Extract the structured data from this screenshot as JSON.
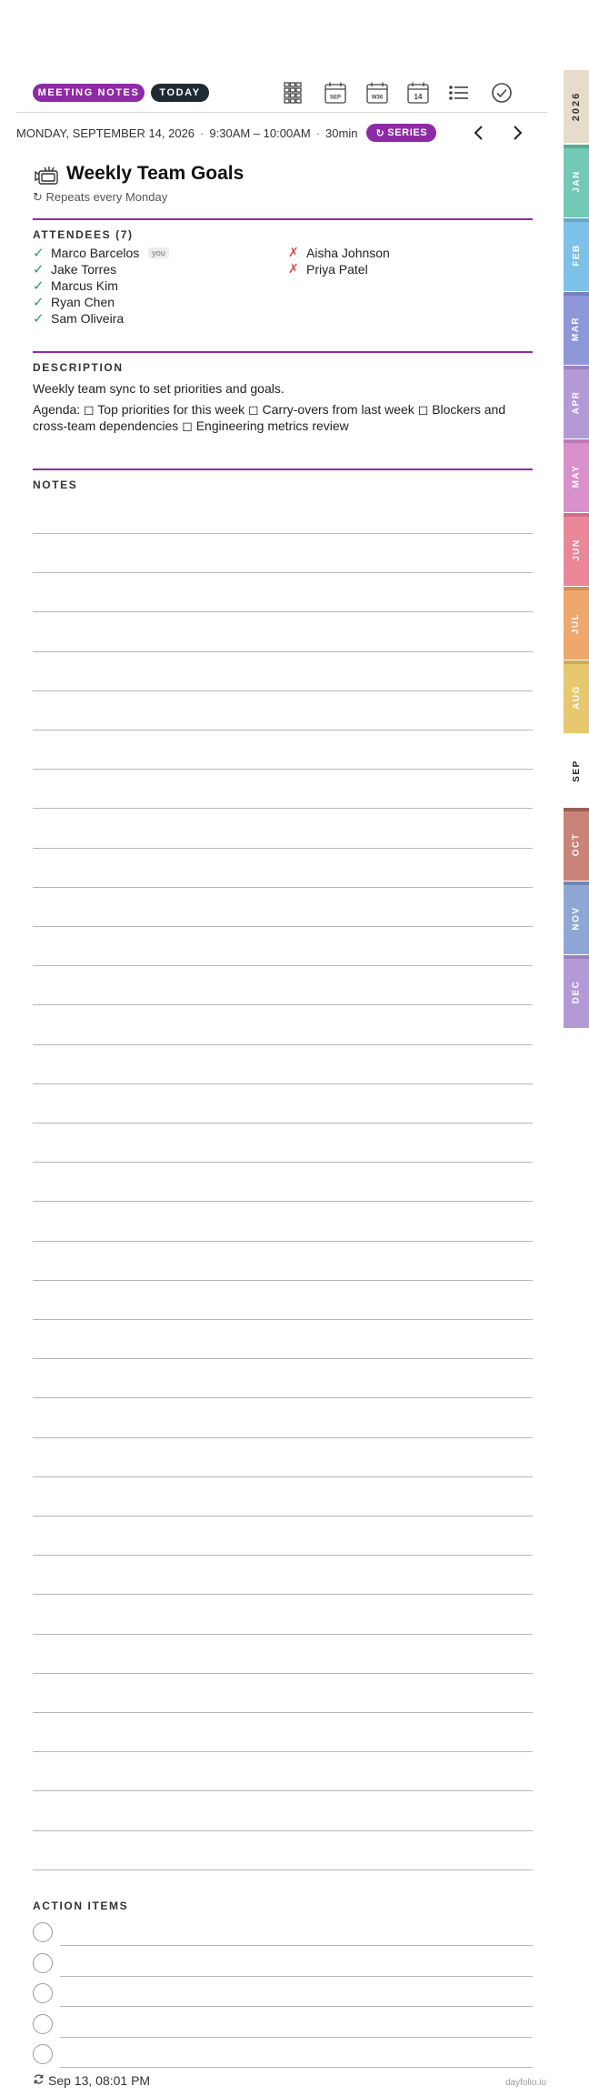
{
  "header": {
    "badge_meeting": "MEETING NOTES",
    "badge_today": "TODAY",
    "tools": [
      {
        "name": "grid-view-icon"
      },
      {
        "name": "month-view-icon",
        "text": "SEP"
      },
      {
        "name": "week-view-icon",
        "text": "W36"
      },
      {
        "name": "day-view-icon",
        "text": "14"
      },
      {
        "name": "list-view-icon"
      },
      {
        "name": "tasks-check-icon"
      }
    ]
  },
  "event": {
    "date": "MONDAY, SEPTEMBER 14, 2026",
    "time": "9:30AM – 10:00AM",
    "duration": "30min",
    "series_label": "SERIES",
    "title": "Weekly Team Goals",
    "repeats": "Repeats every Monday"
  },
  "attendees": {
    "label": "ATTENDEES (7)",
    "you_label": "you",
    "accepted": [
      "Marco Barcelos",
      "Jake Torres",
      "Marcus Kim",
      "Ryan Chen",
      "Sam Oliveira"
    ],
    "declined": [
      "Aisha Johnson",
      "Priya Patel"
    ]
  },
  "description": {
    "label": "DESCRIPTION",
    "summary": "Weekly team sync to set priorities and goals.",
    "agenda": "Agenda: ◻ Top priorities for this week ◻ Carry-overs from last week ◻ Blockers and cross-team dependencies ◻ Engineering metrics review"
  },
  "notes": {
    "label": "NOTES",
    "line_count": 35
  },
  "action_items": {
    "label": "ACTION ITEMS",
    "count": 5
  },
  "footer": {
    "timestamp": "Sep 13, 08:01 PM",
    "brand": "dayfolio.io"
  },
  "tabs": {
    "year": "2026",
    "months": [
      {
        "label": "JAN",
        "color": "#72c9b6",
        "cap": "#5aa896"
      },
      {
        "label": "FEB",
        "color": "#7ec1e8",
        "cap": "#6aa6c8"
      },
      {
        "label": "MAR",
        "color": "#8e97d8",
        "cap": "#7a7fc0"
      },
      {
        "label": "APR",
        "color": "#b39ad6",
        "cap": "#9a80bf"
      },
      {
        "label": "MAY",
        "color": "#d891cc",
        "cap": "#bd78b3"
      },
      {
        "label": "JUN",
        "color": "#ea8799",
        "cap": "#cd6f82"
      },
      {
        "label": "JUL",
        "color": "#eea86e",
        "cap": "#d38e58"
      },
      {
        "label": "AUG",
        "color": "#e6c96e",
        "cap": "#ccad58"
      },
      {
        "label": "SEP",
        "color": "#ffffff",
        "cap": "#ffffff",
        "active": true
      },
      {
        "label": "OCT",
        "color": "#c98379",
        "cap": "#9a6058"
      },
      {
        "label": "NOV",
        "color": "#8ea7d4",
        "cap": "#6f86b5"
      },
      {
        "label": "DEC",
        "color": "#b39ad6",
        "cap": "#9a80bf"
      }
    ],
    "year_color": "#e7dccb"
  }
}
